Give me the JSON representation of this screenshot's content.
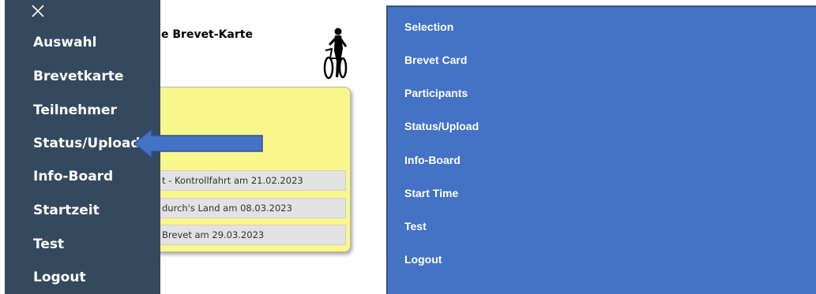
{
  "drawer": {
    "close_icon": "close-icon",
    "items": [
      "Auswahl",
      "Brevetkarte",
      "Teilnehmer",
      "Status/Upload",
      "Info-Board",
      "Startzeit",
      "Test",
      "Logout"
    ]
  },
  "page": {
    "heading_fragment": "e Brevet-Karte",
    "cyclist_icon": "cyclist-with-bicycle-icon"
  },
  "events": [
    "t - Kontrollfahrt am 21.02.2023",
    "durch's Land am 08.03.2023",
    "Brevet am 29.03.2023"
  ],
  "annotation": {
    "arrow": "left-pointing-arrow",
    "arrow_color": "#4472c4"
  },
  "english_menu": {
    "items": [
      "Selection",
      "Brevet Card",
      "Participants",
      "Status/Upload",
      "Info-Board",
      "Start Time",
      "Test",
      "Logout"
    ],
    "background": "#4472c4"
  },
  "colors": {
    "drawer_bg": "#34495e",
    "card_bg": "#f9f68c"
  }
}
